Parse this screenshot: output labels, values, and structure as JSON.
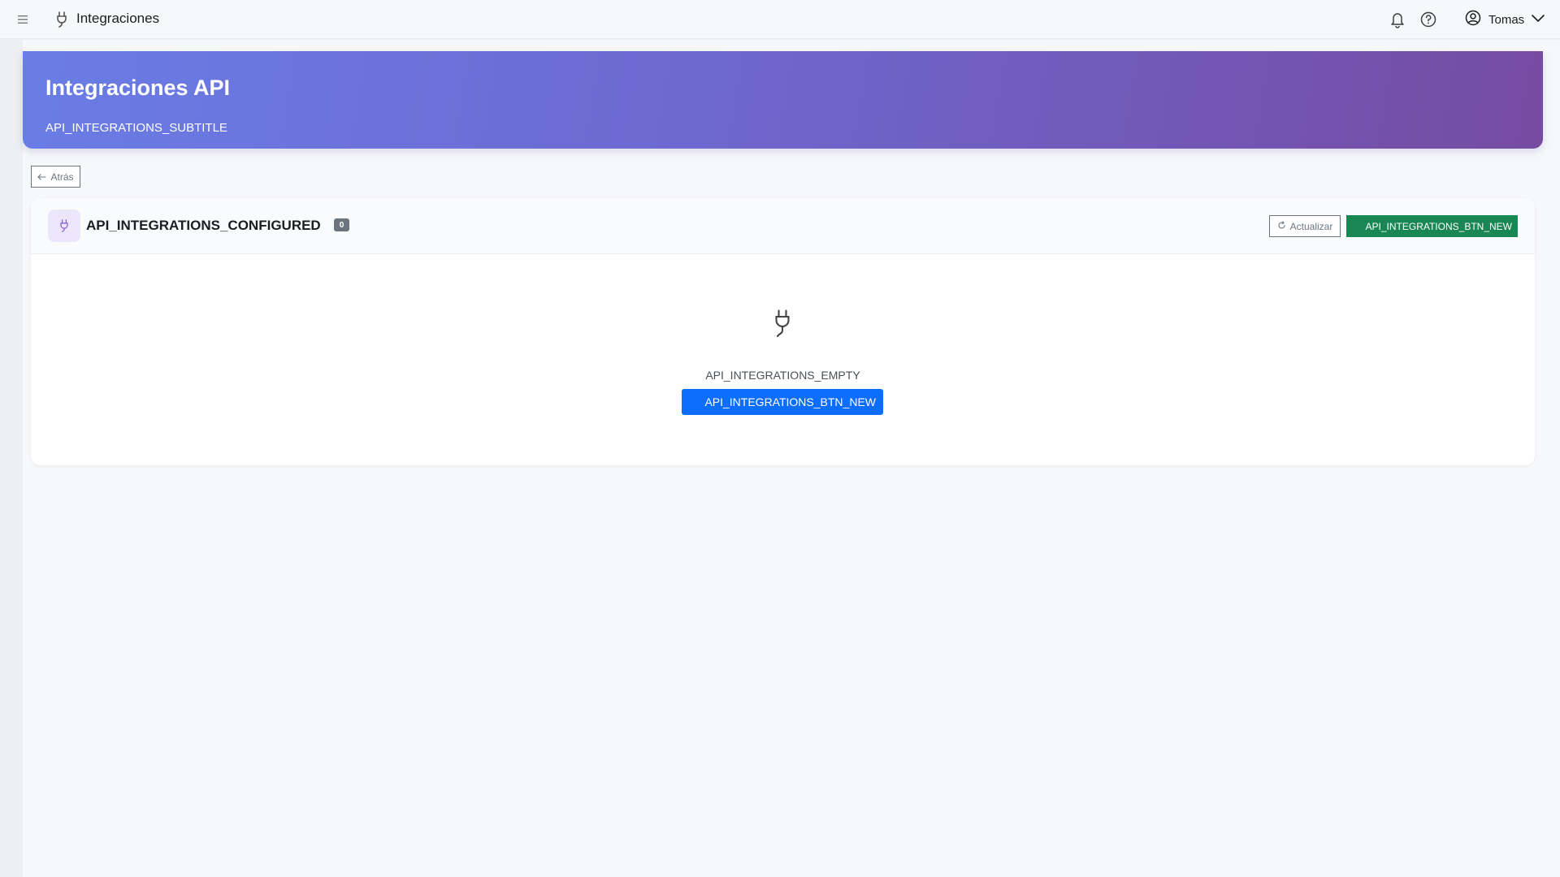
{
  "header": {
    "app_title": "Integraciones",
    "user_name": "Tomas",
    "icons": [
      "menu-icon",
      "plug-icon",
      "bell-icon",
      "help-icon",
      "user-circle-icon",
      "chevron-down-icon"
    ]
  },
  "hero": {
    "title": "Integraciones API",
    "subtitle": "API_INTEGRATIONS_SUBTITLE",
    "gradient_start": "#667eea",
    "gradient_end": "#764ba2"
  },
  "back_button": {
    "label": "Atrás"
  },
  "integrations_card": {
    "heading": "API_INTEGRATIONS_CONFIGURED",
    "count": "0",
    "refresh_label": "Actualizar",
    "new_button_label": "API_INTEGRATIONS_BTN_NEW",
    "empty_text": "API_INTEGRATIONS_EMPTY",
    "empty_button_label": "API_INTEGRATIONS_BTN_NEW"
  },
  "colors": {
    "success": "#198754",
    "primary": "#0d6efd",
    "secondary": "#6c757d",
    "icon_bg": "#ece6fb"
  }
}
